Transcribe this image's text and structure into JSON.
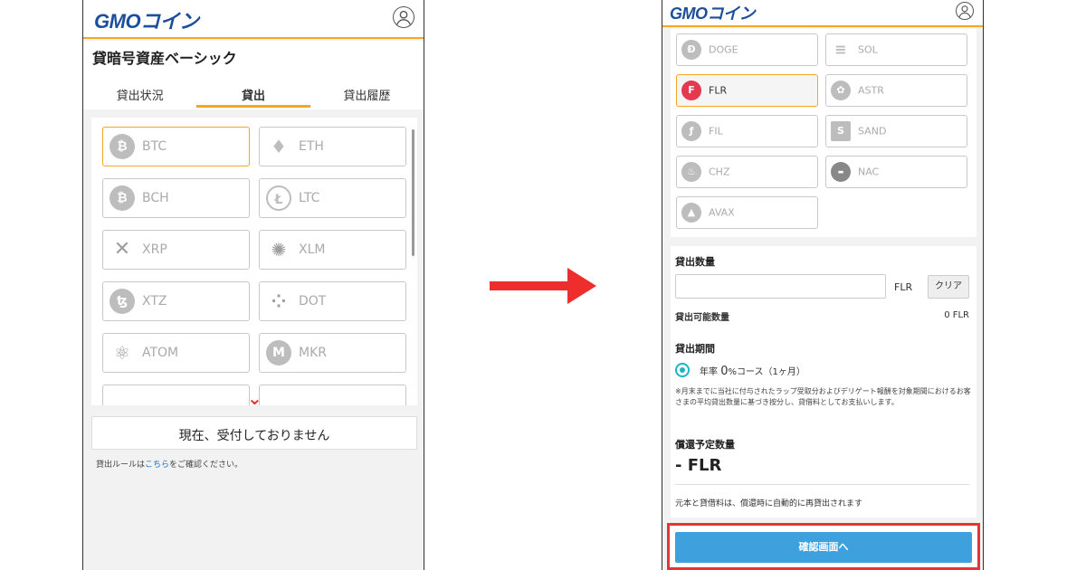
{
  "left": {
    "logo": "GMOコイン",
    "page_title": "貸暗号資産ベーシック",
    "tabs": [
      "貸出状況",
      "貸出",
      "貸出履歴"
    ],
    "active_tab": "貸出",
    "coins": [
      {
        "symbol": "BTC",
        "icon": "bitcoin-icon",
        "selected": true
      },
      {
        "symbol": "ETH",
        "icon": "ethereum-icon",
        "selected": false
      },
      {
        "symbol": "BCH",
        "icon": "bitcoin-cash-icon",
        "selected": false
      },
      {
        "symbol": "LTC",
        "icon": "litecoin-icon",
        "selected": false
      },
      {
        "symbol": "XRP",
        "icon": "xrp-icon",
        "selected": false
      },
      {
        "symbol": "XLM",
        "icon": "stellar-icon",
        "selected": false
      },
      {
        "symbol": "XTZ",
        "icon": "tezos-icon",
        "selected": false
      },
      {
        "symbol": "DOT",
        "icon": "polkadot-icon",
        "selected": false
      },
      {
        "symbol": "ATOM",
        "icon": "cosmos-icon",
        "selected": false
      },
      {
        "symbol": "MKR",
        "icon": "maker-icon",
        "selected": false
      }
    ],
    "notice_button": "現在、受付しておりません",
    "rule_prefix": "貸出ルールは",
    "rule_link": "こちら",
    "rule_suffix": "をご確認ください。"
  },
  "right": {
    "logo": "GMOコイン",
    "coins": [
      {
        "symbol": "DOGE",
        "icon": "dogecoin-icon",
        "selected": false
      },
      {
        "symbol": "SOL",
        "icon": "solana-icon",
        "selected": false
      },
      {
        "symbol": "FLR",
        "icon": "flare-icon",
        "selected": true
      },
      {
        "symbol": "ASTR",
        "icon": "astar-icon",
        "selected": false
      },
      {
        "symbol": "FIL",
        "icon": "filecoin-icon",
        "selected": false
      },
      {
        "symbol": "SAND",
        "icon": "sandbox-icon",
        "selected": false
      },
      {
        "symbol": "CHZ",
        "icon": "chiliz-icon",
        "selected": false
      },
      {
        "symbol": "NAC",
        "icon": "nac-icon",
        "selected": false
      },
      {
        "symbol": "AVAX",
        "icon": "avalanche-icon",
        "selected": false
      }
    ],
    "amount_label": "貸出数量",
    "amount_value": "",
    "amount_unit": "FLR",
    "clear_button": "クリア",
    "available_label": "貸出可能数量",
    "available_value": "0 FLR",
    "period_label": "貸出期間",
    "course_prefix": "年率 ",
    "course_rate": "0",
    "course_suffix": "%コース（1ヶ月）",
    "note": "※月末までに当社に付与されたラップ受取分およびデリゲート報酬を対象期間におけるお客さまの平均貸出数量に基づき按分し、貸借料としてお支払いします。",
    "repay_label": "償還予定数量",
    "repay_value": "- FLR",
    "auto_relend": "元本と貸借料は、償還時に自動的に再貸出されます",
    "confirm_button": "確認画面へ"
  },
  "colors": {
    "accent": "#f5a623",
    "brand": "#1b4f9c",
    "confirm": "#3ea0dc",
    "highlight": "#e63333",
    "radio": "#1bb5c4"
  }
}
